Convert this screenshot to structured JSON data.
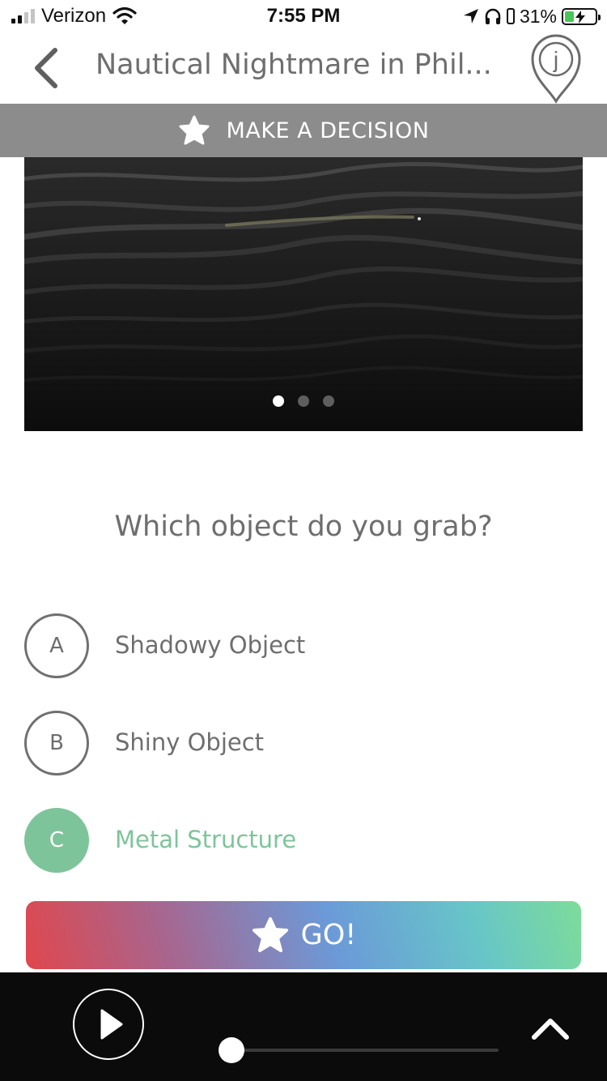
{
  "status_bar": {
    "carrier": "Verizon",
    "time": "7:55 PM",
    "battery_percent": "31%",
    "battery_level": 0.31,
    "signal_bars": 2,
    "icons": [
      "signal-icon",
      "wifi-icon",
      "location-arrow-icon",
      "headphones-icon",
      "lock-rotation-icon",
      "battery-charging-icon"
    ]
  },
  "nav": {
    "title": "Nautical Nightmare in Phil...",
    "back_icon": "chevron-left-icon",
    "logo_letter": "j"
  },
  "banner": {
    "label": "MAKE A DECISION",
    "icon": "star-icon"
  },
  "carousel": {
    "slide_count": 3,
    "active_index": 0
  },
  "question": "Which object do you grab?",
  "options": [
    {
      "letter": "A",
      "label": "Shadowy Object",
      "selected": false
    },
    {
      "letter": "B",
      "label": "Shiny Object",
      "selected": false
    },
    {
      "letter": "C",
      "label": "Metal Structure",
      "selected": true
    }
  ],
  "go_button": {
    "label": "GO!",
    "icon": "star-icon"
  },
  "player": {
    "progress": 0.0,
    "play_icon": "play-icon",
    "expand_icon": "chevron-up-icon"
  },
  "colors": {
    "text_gray": "#6e6e6e",
    "banner_gray": "#8c8c8c",
    "selected_green": "#7ec49a",
    "player_bg": "#0b0b0b",
    "go_gradient": [
      "#e0474d",
      "#6b9ad8",
      "#7ddc9a"
    ]
  }
}
